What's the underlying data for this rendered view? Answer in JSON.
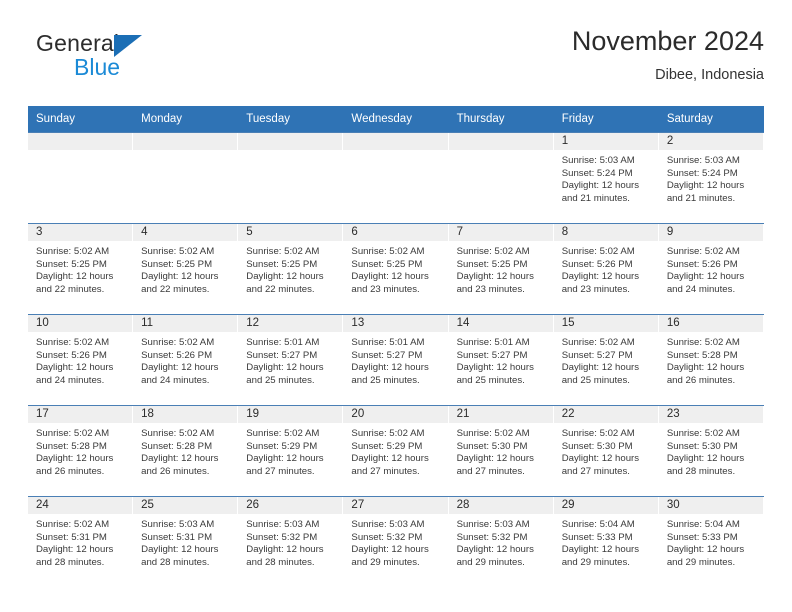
{
  "branding": {
    "name_top": "General",
    "name_bottom": "Blue",
    "triangle_color": "#1b6eb5",
    "blue_text_color": "#1b8ad6"
  },
  "header": {
    "title": "November 2024",
    "subtitle": "Dibee, Indonesia"
  },
  "theme": {
    "header_blue": "#2f73b5",
    "day_strip_gray": "#efefef",
    "row_divider": "#4a7fb5"
  },
  "weekdays": [
    "Sunday",
    "Monday",
    "Tuesday",
    "Wednesday",
    "Thursday",
    "Friday",
    "Saturday"
  ],
  "weeks": [
    [
      {
        "day": "",
        "lines": []
      },
      {
        "day": "",
        "lines": []
      },
      {
        "day": "",
        "lines": []
      },
      {
        "day": "",
        "lines": []
      },
      {
        "day": "",
        "lines": []
      },
      {
        "day": "1",
        "lines": [
          "Sunrise: 5:03 AM",
          "Sunset: 5:24 PM",
          "Daylight: 12 hours",
          "and 21 minutes."
        ]
      },
      {
        "day": "2",
        "lines": [
          "Sunrise: 5:03 AM",
          "Sunset: 5:24 PM",
          "Daylight: 12 hours",
          "and 21 minutes."
        ]
      }
    ],
    [
      {
        "day": "3",
        "lines": [
          "Sunrise: 5:02 AM",
          "Sunset: 5:25 PM",
          "Daylight: 12 hours",
          "and 22 minutes."
        ]
      },
      {
        "day": "4",
        "lines": [
          "Sunrise: 5:02 AM",
          "Sunset: 5:25 PM",
          "Daylight: 12 hours",
          "and 22 minutes."
        ]
      },
      {
        "day": "5",
        "lines": [
          "Sunrise: 5:02 AM",
          "Sunset: 5:25 PM",
          "Daylight: 12 hours",
          "and 22 minutes."
        ]
      },
      {
        "day": "6",
        "lines": [
          "Sunrise: 5:02 AM",
          "Sunset: 5:25 PM",
          "Daylight: 12 hours",
          "and 23 minutes."
        ]
      },
      {
        "day": "7",
        "lines": [
          "Sunrise: 5:02 AM",
          "Sunset: 5:25 PM",
          "Daylight: 12 hours",
          "and 23 minutes."
        ]
      },
      {
        "day": "8",
        "lines": [
          "Sunrise: 5:02 AM",
          "Sunset: 5:26 PM",
          "Daylight: 12 hours",
          "and 23 minutes."
        ]
      },
      {
        "day": "9",
        "lines": [
          "Sunrise: 5:02 AM",
          "Sunset: 5:26 PM",
          "Daylight: 12 hours",
          "and 24 minutes."
        ]
      }
    ],
    [
      {
        "day": "10",
        "lines": [
          "Sunrise: 5:02 AM",
          "Sunset: 5:26 PM",
          "Daylight: 12 hours",
          "and 24 minutes."
        ]
      },
      {
        "day": "11",
        "lines": [
          "Sunrise: 5:02 AM",
          "Sunset: 5:26 PM",
          "Daylight: 12 hours",
          "and 24 minutes."
        ]
      },
      {
        "day": "12",
        "lines": [
          "Sunrise: 5:01 AM",
          "Sunset: 5:27 PM",
          "Daylight: 12 hours",
          "and 25 minutes."
        ]
      },
      {
        "day": "13",
        "lines": [
          "Sunrise: 5:01 AM",
          "Sunset: 5:27 PM",
          "Daylight: 12 hours",
          "and 25 minutes."
        ]
      },
      {
        "day": "14",
        "lines": [
          "Sunrise: 5:01 AM",
          "Sunset: 5:27 PM",
          "Daylight: 12 hours",
          "and 25 minutes."
        ]
      },
      {
        "day": "15",
        "lines": [
          "Sunrise: 5:02 AM",
          "Sunset: 5:27 PM",
          "Daylight: 12 hours",
          "and 25 minutes."
        ]
      },
      {
        "day": "16",
        "lines": [
          "Sunrise: 5:02 AM",
          "Sunset: 5:28 PM",
          "Daylight: 12 hours",
          "and 26 minutes."
        ]
      }
    ],
    [
      {
        "day": "17",
        "lines": [
          "Sunrise: 5:02 AM",
          "Sunset: 5:28 PM",
          "Daylight: 12 hours",
          "and 26 minutes."
        ]
      },
      {
        "day": "18",
        "lines": [
          "Sunrise: 5:02 AM",
          "Sunset: 5:28 PM",
          "Daylight: 12 hours",
          "and 26 minutes."
        ]
      },
      {
        "day": "19",
        "lines": [
          "Sunrise: 5:02 AM",
          "Sunset: 5:29 PM",
          "Daylight: 12 hours",
          "and 27 minutes."
        ]
      },
      {
        "day": "20",
        "lines": [
          "Sunrise: 5:02 AM",
          "Sunset: 5:29 PM",
          "Daylight: 12 hours",
          "and 27 minutes."
        ]
      },
      {
        "day": "21",
        "lines": [
          "Sunrise: 5:02 AM",
          "Sunset: 5:30 PM",
          "Daylight: 12 hours",
          "and 27 minutes."
        ]
      },
      {
        "day": "22",
        "lines": [
          "Sunrise: 5:02 AM",
          "Sunset: 5:30 PM",
          "Daylight: 12 hours",
          "and 27 minutes."
        ]
      },
      {
        "day": "23",
        "lines": [
          "Sunrise: 5:02 AM",
          "Sunset: 5:30 PM",
          "Daylight: 12 hours",
          "and 28 minutes."
        ]
      }
    ],
    [
      {
        "day": "24",
        "lines": [
          "Sunrise: 5:02 AM",
          "Sunset: 5:31 PM",
          "Daylight: 12 hours",
          "and 28 minutes."
        ]
      },
      {
        "day": "25",
        "lines": [
          "Sunrise: 5:03 AM",
          "Sunset: 5:31 PM",
          "Daylight: 12 hours",
          "and 28 minutes."
        ]
      },
      {
        "day": "26",
        "lines": [
          "Sunrise: 5:03 AM",
          "Sunset: 5:32 PM",
          "Daylight: 12 hours",
          "and 28 minutes."
        ]
      },
      {
        "day": "27",
        "lines": [
          "Sunrise: 5:03 AM",
          "Sunset: 5:32 PM",
          "Daylight: 12 hours",
          "and 29 minutes."
        ]
      },
      {
        "day": "28",
        "lines": [
          "Sunrise: 5:03 AM",
          "Sunset: 5:32 PM",
          "Daylight: 12 hours",
          "and 29 minutes."
        ]
      },
      {
        "day": "29",
        "lines": [
          "Sunrise: 5:04 AM",
          "Sunset: 5:33 PM",
          "Daylight: 12 hours",
          "and 29 minutes."
        ]
      },
      {
        "day": "30",
        "lines": [
          "Sunrise: 5:04 AM",
          "Sunset: 5:33 PM",
          "Daylight: 12 hours",
          "and 29 minutes."
        ]
      }
    ]
  ]
}
